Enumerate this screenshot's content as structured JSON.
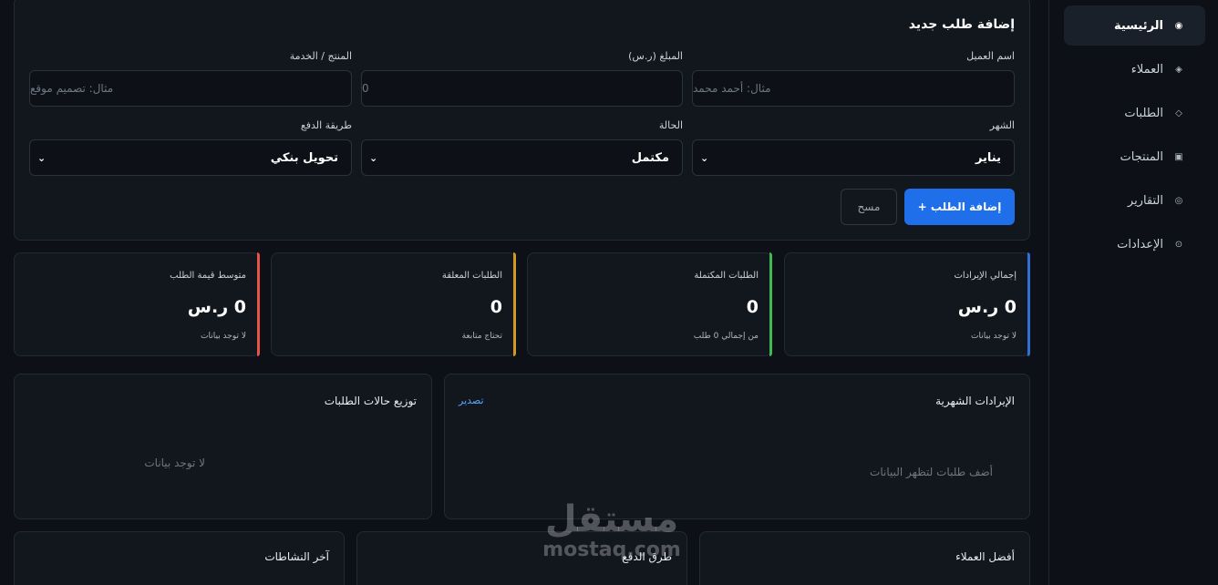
{
  "sidebar": {
    "items": [
      {
        "label": "الرئيسية",
        "icon": "◉"
      },
      {
        "label": "العملاء",
        "icon": "◈"
      },
      {
        "label": "الطلبات",
        "icon": "◇"
      },
      {
        "label": "المنتجات",
        "icon": "▣"
      },
      {
        "label": "التقارير",
        "icon": "◎"
      },
      {
        "label": "الإعدادات",
        "icon": "⊙"
      }
    ]
  },
  "form": {
    "title": "إضافة طلب جديد",
    "customer_label": "اسم العميل",
    "customer_placeholder": "مثال: أحمد محمد",
    "amount_label": "المبلغ (ر.س)",
    "amount_placeholder": "0",
    "product_label": "المنتج / الخدمة",
    "product_placeholder": "مثال: تصميم موقع",
    "month_label": "الشهر",
    "month_value": "يناير",
    "status_label": "الحالة",
    "status_value": "مكتمل",
    "payment_label": "طريقة الدفع",
    "payment_value": "تحويل بنكي",
    "submit_label": "+ إضافة الطلب",
    "clear_label": "مسح",
    "chevron": "⌄"
  },
  "stats": [
    {
      "title": "إجمالي الإيرادات",
      "value": "0 ر.س",
      "sub": "لا توجد بيانات",
      "color": "#2f6fd6"
    },
    {
      "title": "الطلبات المكتملة",
      "value": "0",
      "sub": "من إجمالي 0 طلب",
      "color": "#3fb950"
    },
    {
      "title": "الطلبات المعلقة",
      "value": "0",
      "sub": "تحتاج متابعة",
      "color": "#d29922"
    },
    {
      "title": "متوسط قيمة الطلب",
      "value": "0 ر.س",
      "sub": "لا توجد بيانات",
      "color": "#e5534b"
    }
  ],
  "charts": {
    "revenue_title": "الإيرادات الشهرية",
    "revenue_export": "تصدير",
    "revenue_empty": "أضف طلبات لتظهر البيانات",
    "status_title": "توزيع حالات الطلبات",
    "status_empty": "لا توجد بيانات"
  },
  "bottom": {
    "top_customers": "أفضل العملاء",
    "payment_methods": "طرق الدفع",
    "activity": "آخر النشاطات"
  },
  "watermark": {
    "arabic": "مستقل",
    "latin": "mostaq.com"
  }
}
